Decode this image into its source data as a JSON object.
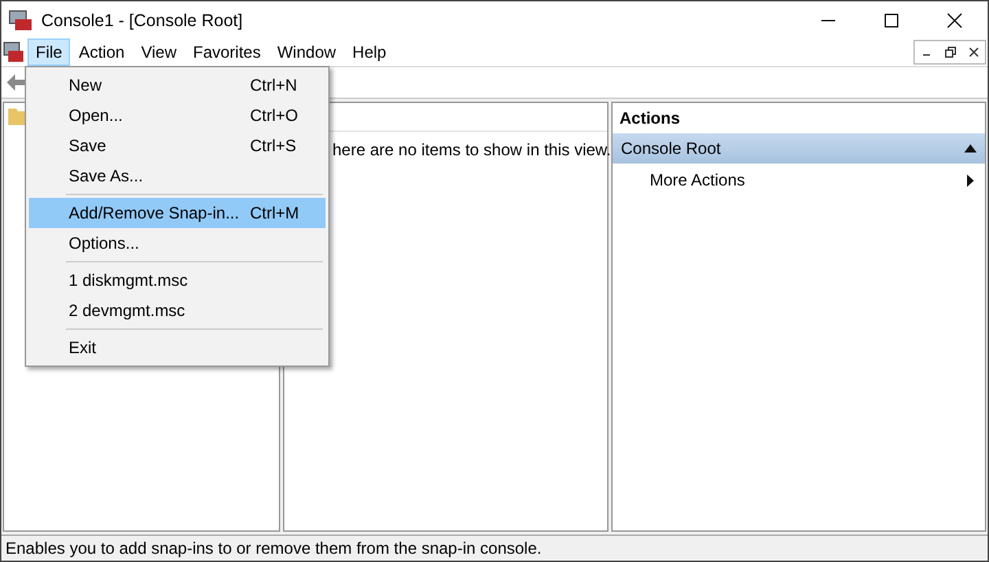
{
  "window": {
    "title": "Console1 - [Console Root]"
  },
  "menubar": [
    {
      "label": "File",
      "selected": true
    },
    {
      "label": "Action",
      "selected": false
    },
    {
      "label": "View",
      "selected": false
    },
    {
      "label": "Favorites",
      "selected": false
    },
    {
      "label": "Window",
      "selected": false
    },
    {
      "label": "Help",
      "selected": false
    }
  ],
  "file_menu": [
    {
      "kind": "item",
      "label": "New",
      "shortcut": "Ctrl+N",
      "selected": false
    },
    {
      "kind": "item",
      "label": "Open...",
      "shortcut": "Ctrl+O",
      "selected": false
    },
    {
      "kind": "item",
      "label": "Save",
      "shortcut": "Ctrl+S",
      "selected": false
    },
    {
      "kind": "item",
      "label": "Save As...",
      "selected": false
    },
    {
      "kind": "separator"
    },
    {
      "kind": "item",
      "label": "Add/Remove Snap-in...",
      "shortcut": "Ctrl+M",
      "selected": true
    },
    {
      "kind": "item",
      "label": "Options...",
      "selected": false
    },
    {
      "kind": "separator"
    },
    {
      "kind": "item",
      "label": "1 diskmgmt.msc",
      "selected": false
    },
    {
      "kind": "item",
      "label": "2 devmgmt.msc",
      "selected": false
    },
    {
      "kind": "separator"
    },
    {
      "kind": "item",
      "label": "Exit",
      "selected": false
    }
  ],
  "results_pane": {
    "message": "here are no items to show in this view."
  },
  "actions_pane": {
    "title": "Actions",
    "section": "Console Root",
    "items": [
      "More Actions"
    ]
  },
  "status_bar": "Enables you to add snap-ins to or remove them from the snap-in console."
}
